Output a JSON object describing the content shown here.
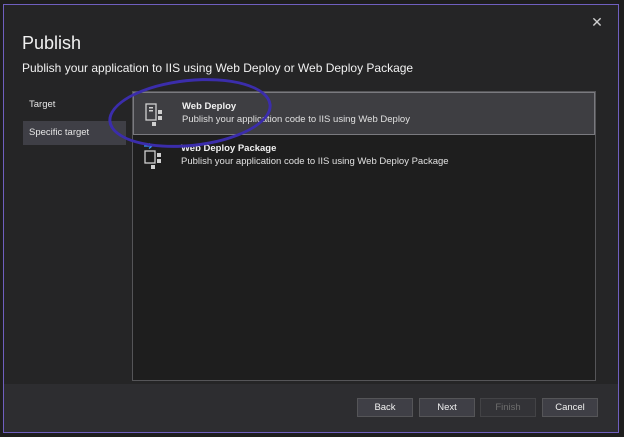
{
  "dialog": {
    "title": "Publish",
    "subtitle": "Publish your application to IIS using Web Deploy or Web Deploy Package",
    "close_icon": "close-icon"
  },
  "nav": {
    "items": [
      {
        "label": "Target",
        "active": false
      },
      {
        "label": "Specific target",
        "active": true
      }
    ]
  },
  "options": [
    {
      "title": "Web Deploy",
      "description": "Publish your application code to IIS using Web Deploy",
      "icon": "web-deploy-icon",
      "selected": true
    },
    {
      "title": "Web Deploy Package",
      "description": "Publish your application code to IIS using Web Deploy Package",
      "icon": "web-deploy-package-icon",
      "selected": false
    }
  ],
  "footer": {
    "back_label": "Back",
    "next_label": "Next",
    "finish_label": "Finish",
    "cancel_label": "Cancel"
  },
  "colors": {
    "dialog_border": "#6f5fbf",
    "annotation_circle": "#3b2dab",
    "accent_arrow": "#3794ff"
  }
}
